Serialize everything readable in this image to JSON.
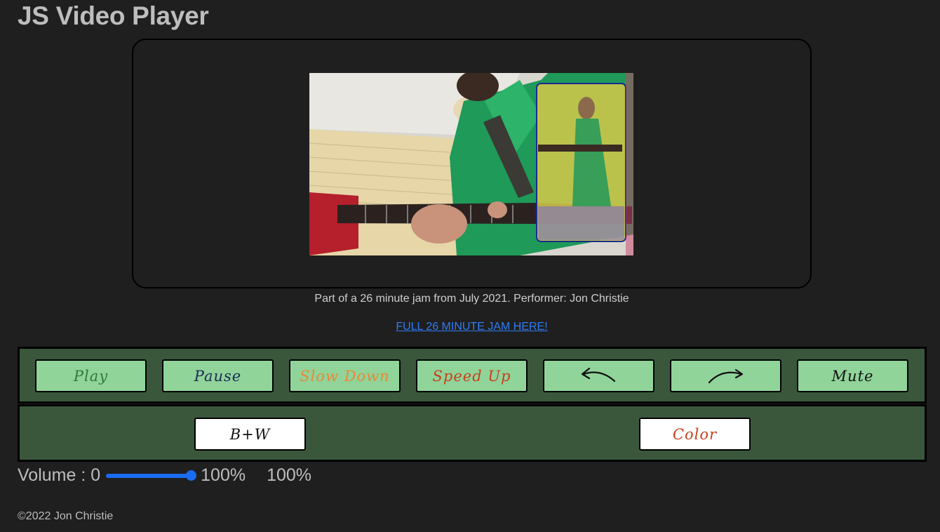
{
  "page": {
    "title": "JS Video Player"
  },
  "video": {
    "caption": "Part of a 26 minute jam from July 2021. Performer: Jon Christie",
    "link_text": "FULL 26 MINUTE JAM HERE!"
  },
  "controls": {
    "play": "Play",
    "pause": "Pause",
    "slow_down": "Slow Down",
    "speed_up": "Speed Up",
    "back_icon": "arrow-back-icon",
    "forward_icon": "arrow-forward-icon",
    "mute": "Mute"
  },
  "filters": {
    "bw": "B+W",
    "color": "Color"
  },
  "volume": {
    "label": "Volume : 0",
    "max_label": "100%",
    "current_display": "100%",
    "value": 1.0
  },
  "footer": {
    "text": "©2022 Jon Christie"
  },
  "colors": {
    "background": "#1f1f1f",
    "panel": "#3a573c",
    "button": "#90d49a",
    "link": "#2f7cf6",
    "slider": "#1a6cf0",
    "play_text": "#2f7a3a",
    "pause_text": "#1c2a55",
    "slow_text": "#e8893a",
    "speed_text": "#c8401a"
  }
}
